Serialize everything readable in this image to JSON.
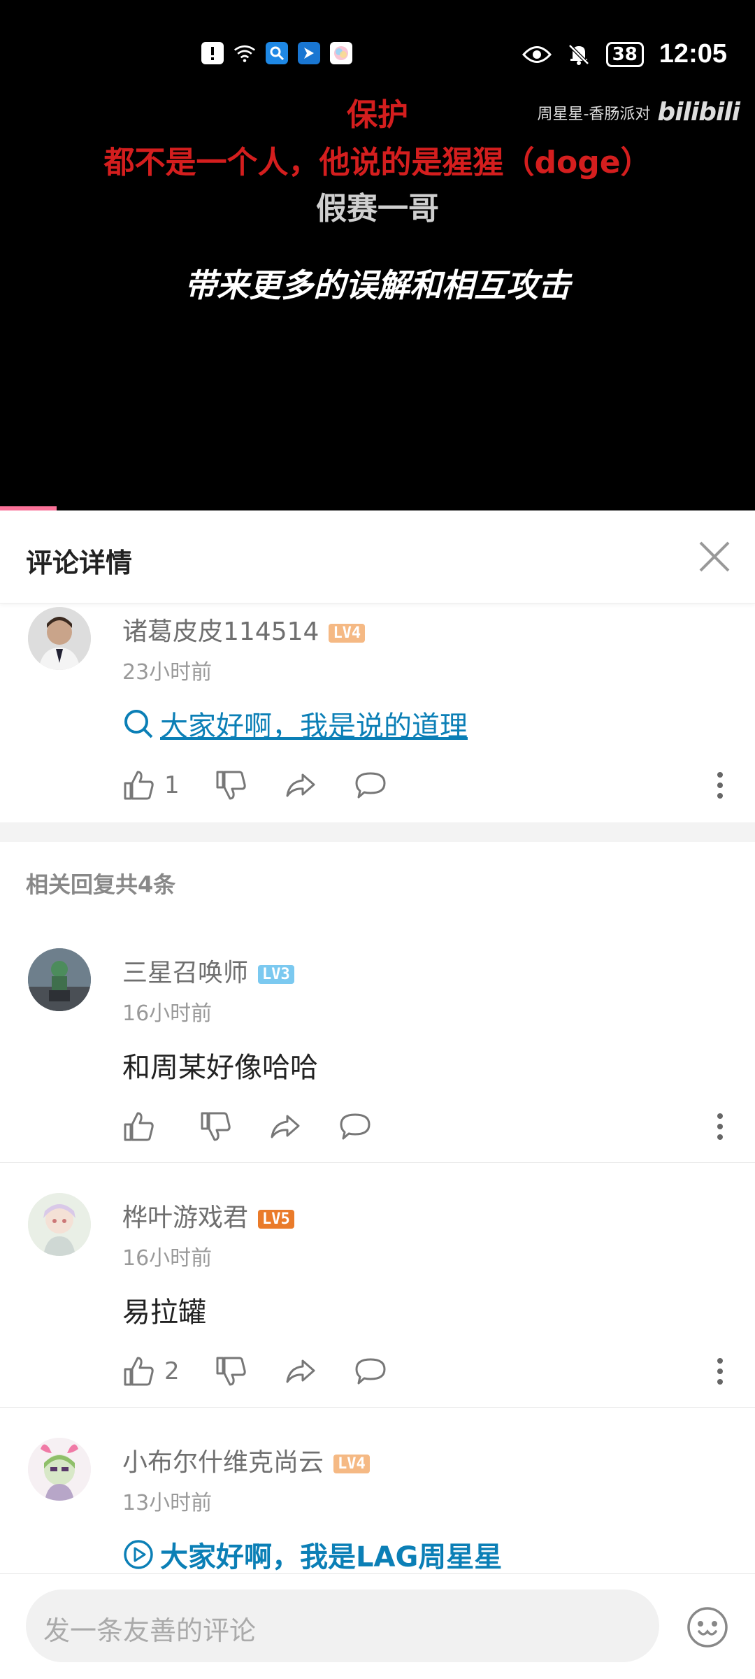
{
  "status_bar": {
    "battery": "38",
    "time": "12:05"
  },
  "video": {
    "watermark_text": "周星星-香肠派对",
    "watermark_logo": "bilibili",
    "danmaku": [
      "保护",
      "都不是一个人，他说的是猩猩（doge）",
      "假赛一哥"
    ],
    "subtitle": "带来更多的误解和相互攻击",
    "progress_fraction": 0.075
  },
  "header": {
    "title": "评论详情"
  },
  "main_comment": {
    "username": "诸葛皮皮114514",
    "level": "LV4",
    "time": "23小时前",
    "text": "大家好啊，我是说的道理",
    "likes": "1"
  },
  "replies_header": "相关回复共4条",
  "replies": [
    {
      "username": "三星召唤师",
      "level": "LV3",
      "time": "16小时前",
      "text": "和周某好像哈哈",
      "likes": ""
    },
    {
      "username": "桦叶游戏君",
      "level": "LV5",
      "time": "16小时前",
      "text": "易拉罐",
      "likes": "2"
    },
    {
      "username": "小布尔什维克尚云",
      "level": "LV4",
      "time": "13小时前",
      "text": "大家好啊，我是LAG周星星",
      "likes": ""
    }
  ],
  "bottom_bar": {
    "input_placeholder": "发一条友善的评论"
  },
  "colors": {
    "accent": "#fb7299",
    "link": "#0b7fb6",
    "lv3": "#7bc9f0",
    "lv4": "#f5b984",
    "lv5": "#ea7b2a"
  }
}
